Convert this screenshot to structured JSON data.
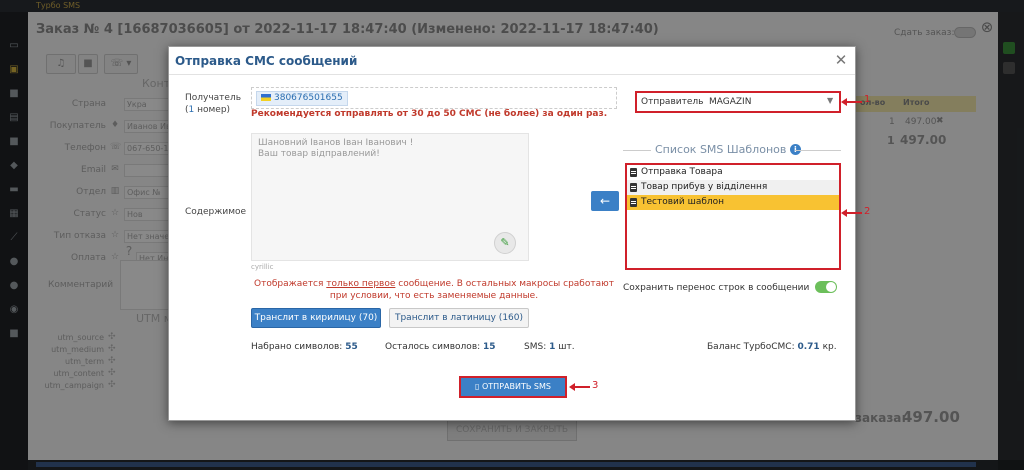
{
  "app": {
    "title": "Турбо SMS"
  },
  "order": {
    "title": "Заказ № 4 [16687036605] от 2022-11-17 18:47:40 (Изменено: 2022-11-17 18:47:40)",
    "rent_label": "Сдать заказ:",
    "contacts_label": "Конт",
    "fields": [
      {
        "label": "Страна",
        "value": "Укра"
      },
      {
        "label": "Покупатель",
        "value": "Иванов Ив"
      },
      {
        "label": "Телефон",
        "value": "067-650-1"
      },
      {
        "label": "Email",
        "value": ""
      },
      {
        "label": "Отдел",
        "value": "Офис №"
      },
      {
        "label": "Статус",
        "value": "Нов"
      },
      {
        "label": "Тип отказа",
        "value": "Нет значе"
      },
      {
        "label": "Оплата",
        "value": "Нет Ин"
      }
    ],
    "comment_label": "Комментарий",
    "utm_title": "UTM м",
    "utm": [
      "utm_source",
      "utm_medium",
      "utm_term",
      "utm_content",
      "utm_campaign"
    ],
    "table": {
      "col_qty": "ол-во",
      "col_total": "Итого",
      "row_qty": "1",
      "row_total": "497.00",
      "sum_qty": "1",
      "sum_total": "497.00"
    },
    "total_label": "заказа:",
    "total_value": "497.00",
    "save_close": "Сохранить и закрыть"
  },
  "modal": {
    "title": "Отправка СМС сообщений",
    "recipient_label": "Получатель",
    "recipient_count_open": "(",
    "recipient_count_num": "1",
    "recipient_count_rest": " номер)",
    "phone": "380676501655",
    "recommend": "Рекомендуется отправлять от 30 до 50 СМС (не более) за один раз.",
    "sender_label": "Отправитель",
    "sender_value": "MAGAZIN",
    "content_label": "Содержимое",
    "message": "Шановний Іванов Іван Іванович !\nВаш товар відправлений!",
    "encoding": "cyrillic",
    "hint_1": "Отображается ",
    "hint_underline": "только первое",
    "hint_2": " сообщение. В остальных макросы сработают при условии, что есть заменяемые данные.",
    "btn_cyr": "Транслит в кирилицу (70)",
    "btn_lat": "Транслит в латиницу (160)",
    "typed_label": "Набрано символов:",
    "typed_value": "55",
    "left_label": "Осталось символов:",
    "left_value": "15",
    "sms_label": "SMS:",
    "sms_value": "1",
    "sms_unit": "шт.",
    "balance_label": "Баланс ТурбоСМС:",
    "balance_value": "0.71",
    "balance_unit": "кр.",
    "templates_title": "Список SMS Шаблонов",
    "templates": [
      "Отправка Товара",
      "Товар прибув у відділення",
      "Тестовий шаблон"
    ],
    "selected_template_index": 2,
    "keep_breaks_label": "Сохранить перенос строк в сообщении",
    "keep_breaks_on": true,
    "send_btn": "Отправить SMS"
  },
  "annotations": [
    "1",
    "2",
    "3"
  ],
  "colors": {
    "accent": "#3b80c6",
    "highlight": "#f8c232",
    "annotation": "#d0202a",
    "toggle": "#6cbf5b"
  }
}
